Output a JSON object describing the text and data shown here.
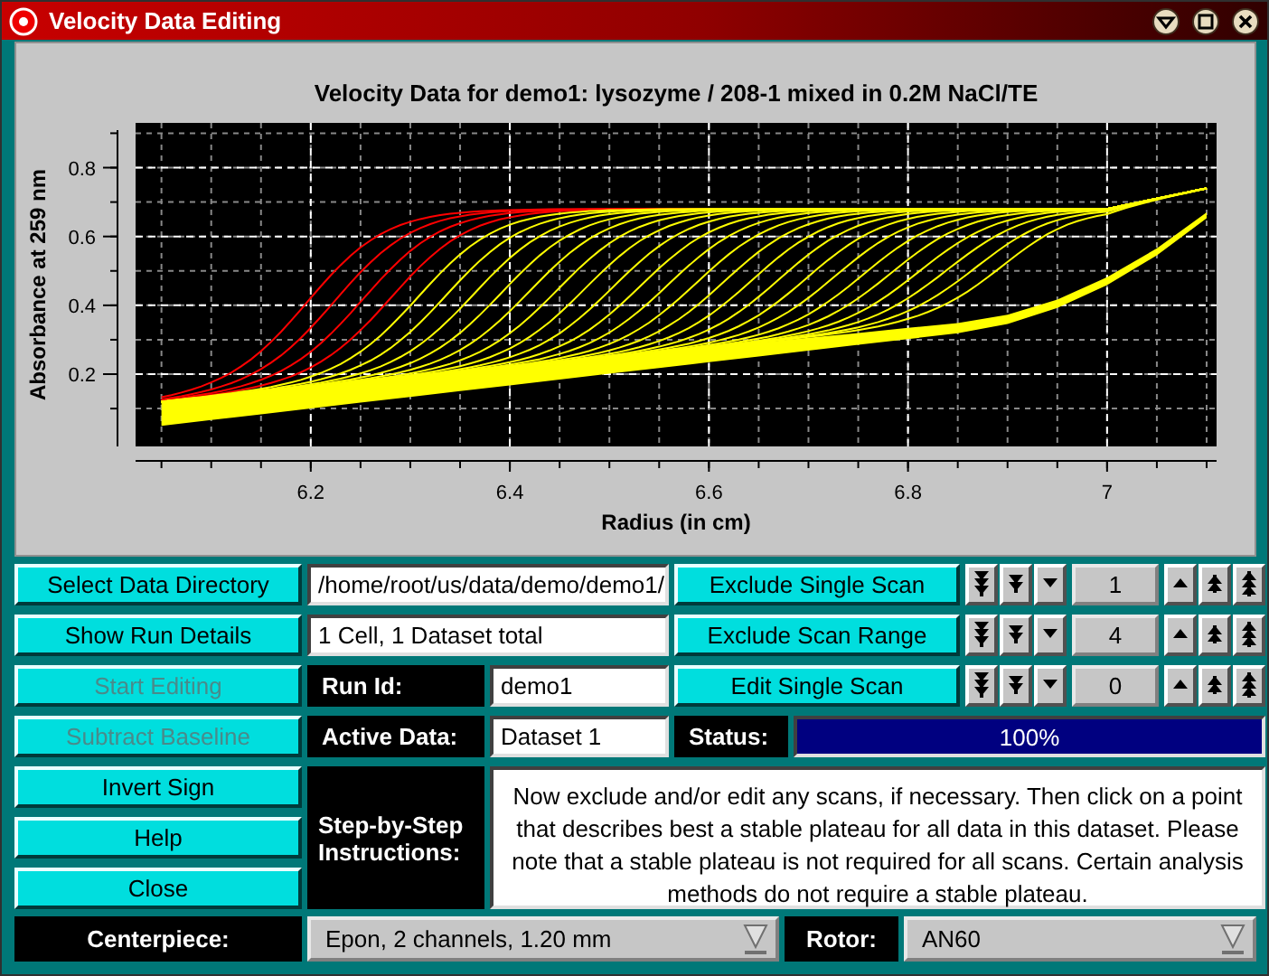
{
  "window": {
    "title": "Velocity Data Editing"
  },
  "chart": {
    "title": "Velocity Data for demo1: lysozyme / 208-1 mixed in 0.2M NaCl/TE",
    "xlabel": "Radius (in cm)",
    "ylabel": "Absorbance at 259 nm",
    "xticks": [
      "6.2",
      "6.4",
      "6.6",
      "6.8",
      "7"
    ],
    "yticks": [
      "0.8",
      "0.6",
      "0.4",
      "0.2"
    ]
  },
  "left_buttons": [
    {
      "label": "Select Data Directory",
      "disabled": false
    },
    {
      "label": "Show Run Details",
      "disabled": false
    },
    {
      "label": "Start Editing",
      "disabled": true
    },
    {
      "label": "Subtract Baseline",
      "disabled": true
    },
    {
      "label": "Invert Sign",
      "disabled": false
    },
    {
      "label": "Help",
      "disabled": false
    },
    {
      "label": "Close",
      "disabled": false
    }
  ],
  "directory": {
    "value": "/home/root/us/data/demo/demo1/"
  },
  "run_details": {
    "value": "1 Cell, 1 Dataset total"
  },
  "run_id": {
    "label": "Run Id:",
    "value": "demo1"
  },
  "active_data": {
    "label": "Active Data:",
    "value": "Dataset 1"
  },
  "scan_controls": [
    {
      "label": "Exclude Single Scan",
      "value": "1"
    },
    {
      "label": "Exclude Scan Range",
      "value": "4"
    },
    {
      "label": "Edit Single Scan",
      "value": "0"
    }
  ],
  "status": {
    "label": "Status:",
    "text": "100%",
    "level": 1
  },
  "instructions": {
    "label": "Step-by-Step Instructions:",
    "text": "Now exclude and/or edit any scans, if necessary. Then click on a point that describes best a stable plateau for all data in this dataset. Please note that a stable plateau is not required for all scans. Certain analysis methods do not require a stable plateau."
  },
  "centerpiece": {
    "label": "Centerpiece:",
    "value": "Epon, 2 channels, 1.20 mm"
  },
  "rotor": {
    "label": "Rotor:",
    "value": "AN60"
  }
}
